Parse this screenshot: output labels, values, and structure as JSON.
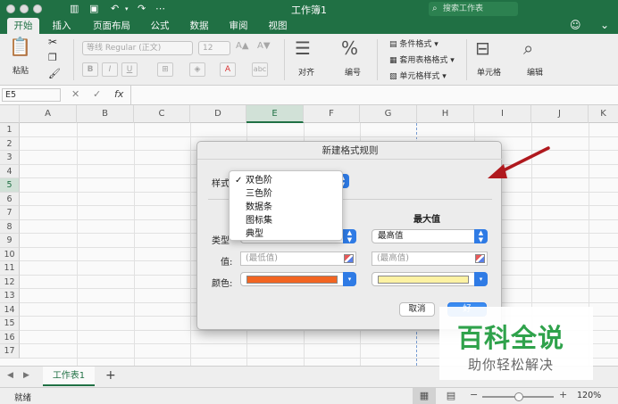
{
  "app": {
    "title": "工作簿1",
    "search_placeholder": "搜索工作表",
    "accent": "#217346"
  },
  "tabs": [
    {
      "label": "开始",
      "active": true
    },
    {
      "label": "插入"
    },
    {
      "label": "页面布局"
    },
    {
      "label": "公式"
    },
    {
      "label": "数据"
    },
    {
      "label": "审阅"
    },
    {
      "label": "视图"
    }
  ],
  "ribbon": {
    "paste_label": "粘贴",
    "font_name": "等线 Regular (正文)",
    "font_size": "12",
    "align_label": "对齐",
    "number_label": "编号",
    "cond_format_label": "条件格式",
    "table_format_label": "套用表格格式",
    "cell_style_label": "单元格样式",
    "cells_label": "单元格",
    "edit_label": "编辑"
  },
  "formula_bar": {
    "name_box": "E5",
    "fx": "fx"
  },
  "columns": [
    "A",
    "B",
    "C",
    "D",
    "E",
    "F",
    "G",
    "H",
    "I",
    "J",
    "K"
  ],
  "selected_column": "E",
  "rows": [
    "1",
    "2",
    "3",
    "4",
    "5",
    "6",
    "7",
    "8",
    "9",
    "10",
    "11",
    "12",
    "13",
    "14",
    "15",
    "16",
    "17"
  ],
  "selected_row": "5",
  "sheet": {
    "tab_label": "工作表1",
    "add_label": "+"
  },
  "status": {
    "ready": "就绪",
    "zoom": "120%",
    "zoom_minus": "−",
    "zoom_plus": "+"
  },
  "dialog": {
    "title": "新建格式规则",
    "style_label": "样式",
    "max_header": "最大值",
    "type_label": "类型",
    "value_label": "值:",
    "color_label": "颜色:",
    "max_type": "最高值",
    "min_value_placeholder": "(最低值)",
    "max_value_placeholder": "(最高值)",
    "min_color": "#f26522",
    "max_color": "#fdf2a3",
    "cancel_label": "取消",
    "ok_label": "好"
  },
  "style_menu": {
    "items": [
      "双色阶",
      "三色阶",
      "数据条",
      "图标集",
      "典型"
    ],
    "checked_index": 0
  },
  "watermark": {
    "title": "百科全说",
    "subtitle": "助你轻松解决"
  }
}
